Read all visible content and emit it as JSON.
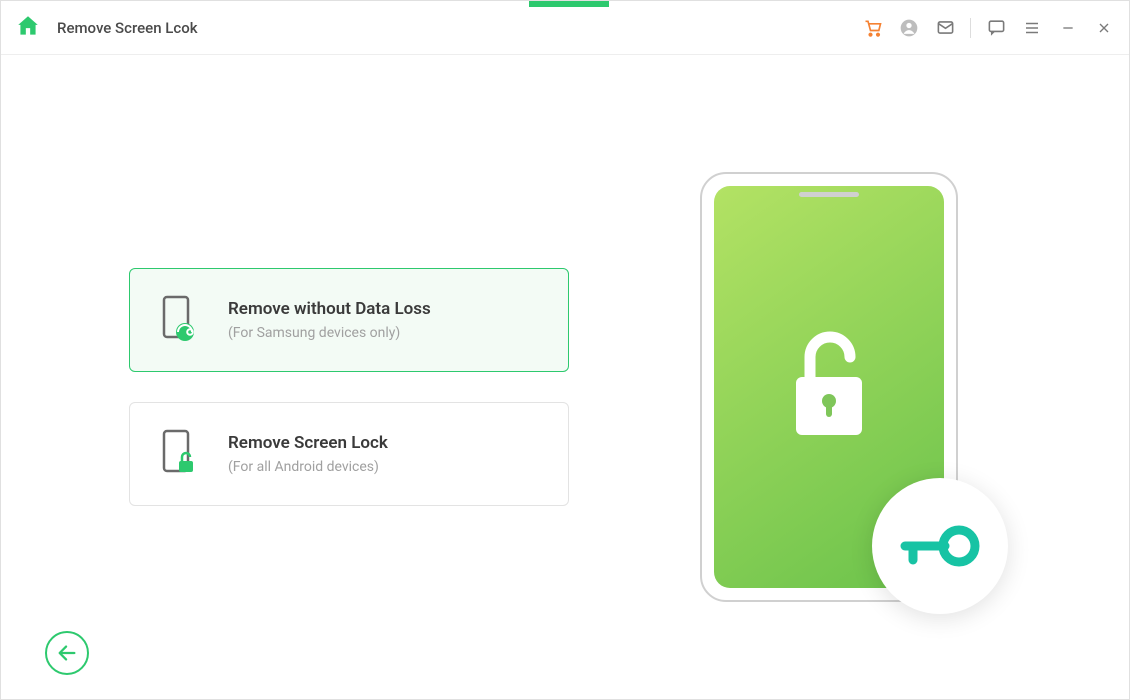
{
  "header": {
    "title": "Remove Screen Lcok"
  },
  "options": [
    {
      "title": "Remove without Data Loss",
      "subtitle": "(For Samsung devices only)"
    },
    {
      "title": "Remove Screen Lock",
      "subtitle": "(For all Android devices)"
    }
  ],
  "colors": {
    "accent": "#2dc96e",
    "cart": "#f58233"
  }
}
